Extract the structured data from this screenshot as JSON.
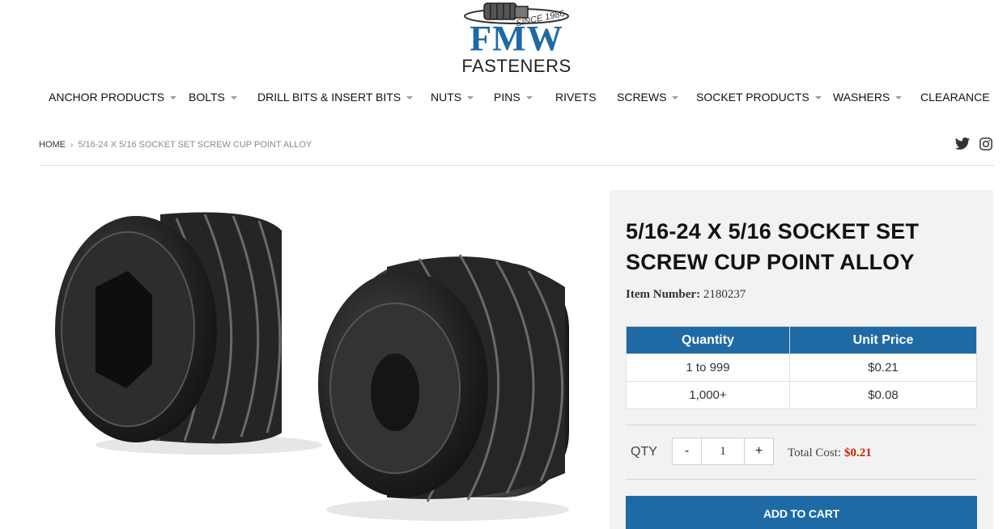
{
  "logo": {
    "since": "SINCE 1986",
    "wordmark": "FMW",
    "sub": "FASTENERS",
    "color": "#1f6aa5"
  },
  "nav": [
    {
      "label": "ANCHOR PRODUCTS",
      "dropdown": true
    },
    {
      "label": "BOLTS",
      "dropdown": true
    },
    {
      "label": "DRILL BITS & INSERT BITS",
      "dropdown": true
    },
    {
      "label": "NUTS",
      "dropdown": true
    },
    {
      "label": "PINS",
      "dropdown": true
    },
    {
      "label": "RIVETS",
      "dropdown": false
    },
    {
      "label": "SCREWS",
      "dropdown": true
    },
    {
      "label": "SOCKET PRODUCTS",
      "dropdown": true
    },
    {
      "label": "WASHERS",
      "dropdown": true
    },
    {
      "label": "CLEARANCE",
      "dropdown": false
    }
  ],
  "breadcrumb": {
    "home": "HOME",
    "separator": "›",
    "current": "5/16-24 X 5/16 SOCKET SET SCREW CUP POINT ALLOY"
  },
  "social": [
    "twitter-icon",
    "instagram-icon"
  ],
  "product": {
    "title": "5/16-24 X 5/16 SOCKET SET SCREW CUP POINT ALLOY",
    "item_number_label": "Item Number:",
    "item_number": "2180237",
    "pricing": {
      "headers": [
        "Quantity",
        "Unit Price"
      ],
      "rows": [
        [
          "1 to 999",
          "$0.21"
        ],
        [
          "1,000+",
          "$0.08"
        ]
      ]
    },
    "qty_label": "QTY",
    "qty_minus": "-",
    "qty_plus": "+",
    "qty_value": "1",
    "total_label": "Total Cost:",
    "total_value": "$0.21",
    "add_to_cart": "ADD TO CART"
  },
  "colors": {
    "brand": "#1f6aa5",
    "price": "#cc2200",
    "panel": "#f2f2f2"
  }
}
